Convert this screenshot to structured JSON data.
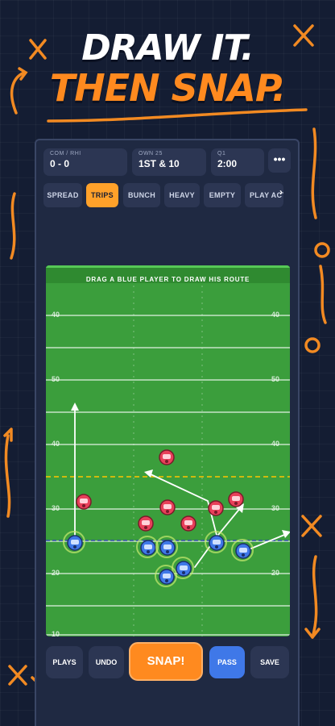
{
  "headline": {
    "line1": "DRAW IT.",
    "line2": "THEN SNAP."
  },
  "scoreboard": [
    {
      "label": "COM / RHI",
      "value": "0 - 0"
    },
    {
      "label": "OWN 25",
      "value": "1ST & 10"
    },
    {
      "label": "Q1",
      "value": "2:00"
    }
  ],
  "more_label": "•••",
  "formations": [
    "SPREAD",
    "TRIPS",
    "BUNCH",
    "HEAVY",
    "EMPTY",
    "PLAY ACTION"
  ],
  "active_formation": "TRIPS",
  "field": {
    "instruction": "DRAG A BLUE PLAYER TO DRAW HIS ROUTE",
    "yard_labels": [
      "40",
      "50",
      "40",
      "30",
      "20",
      "10"
    ]
  },
  "actions": {
    "plays": "PLAYS",
    "undo": "UNDO",
    "snap": "SNAP!",
    "pass": "PASS",
    "save": "SAVE"
  },
  "colors": {
    "accent": "#ff8a1f",
    "field": "#3b9e3c",
    "offense": "#3f78e8",
    "defense": "#e8405a",
    "first_down_line": "#ffc400",
    "scrimmage_line": "#2f4fa8"
  }
}
